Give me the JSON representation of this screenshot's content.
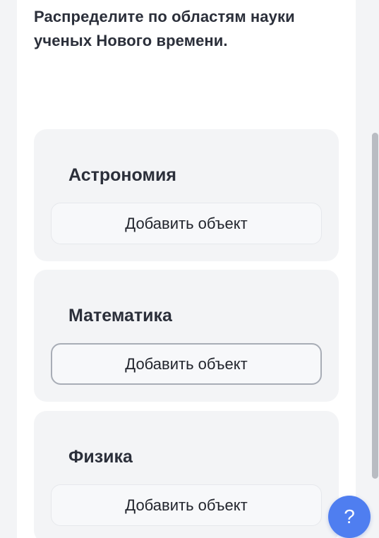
{
  "question": {
    "text": "Распределите по областям науки ученых Нового времени."
  },
  "categories": [
    {
      "title": "Астрономия",
      "add_label": "Добавить объект",
      "focused": false
    },
    {
      "title": "Математика",
      "add_label": "Добавить объект",
      "focused": true
    },
    {
      "title": "Физика",
      "add_label": "Добавить объект",
      "focused": false
    }
  ],
  "help": {
    "label": "?",
    "icon": "question-mark-icon"
  },
  "colors": {
    "card_background": "#f3f4f6",
    "help_button": "#4f7ef0",
    "text": "#2b2f3a"
  }
}
